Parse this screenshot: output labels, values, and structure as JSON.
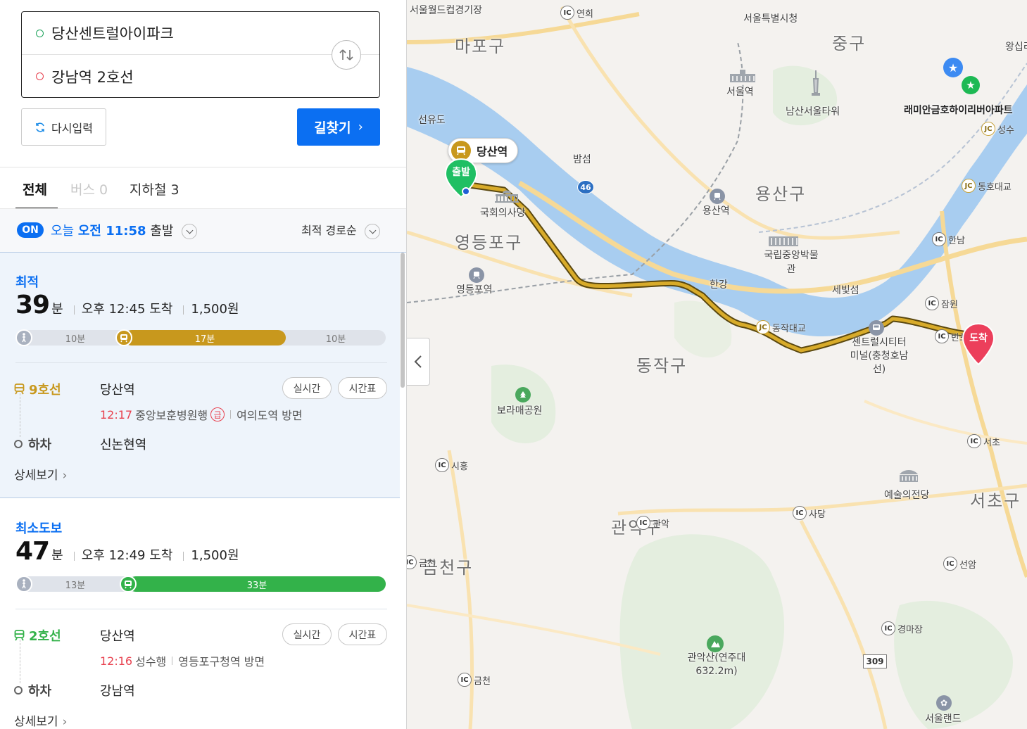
{
  "search": {
    "origin": "당산센트럴아이파크",
    "destination": "강남역 2호선",
    "reset_label": "다시입력",
    "search_label": "길찾기"
  },
  "tabs": [
    {
      "label": "전체",
      "count": ""
    },
    {
      "label": "버스",
      "count": "0"
    },
    {
      "label": "지하철",
      "count": "3"
    }
  ],
  "departure": {
    "badge": "ON",
    "day": "오늘",
    "time": "오전 11:58",
    "suffix": "출발",
    "sort": "최적 경로순"
  },
  "routes": [
    {
      "type": "최적",
      "minutes": "39",
      "unit": "분",
      "arrival": "오후 12:45 도착",
      "fare": "1,500원",
      "segments": [
        {
          "kind": "walk",
          "label": "10분",
          "minutes": 10
        },
        {
          "kind": "subway",
          "label": "17분",
          "minutes": 17
        },
        {
          "kind": "walk",
          "label": "10분",
          "minutes": 10
        }
      ],
      "line_name": "9호선",
      "line_color": "#c8981d",
      "board_station": "당산역",
      "realtime_label": "실시간",
      "timetable_label": "시간표",
      "depart_time": "12:17",
      "direction": "중앙보훈병원행",
      "express": "급",
      "heading": "여의도역 방면",
      "alight_label": "하차",
      "alight_station": "신논현역",
      "detail_label": "상세보기"
    },
    {
      "type": "최소도보",
      "minutes": "47",
      "unit": "분",
      "arrival": "오후 12:49 도착",
      "fare": "1,500원",
      "segments": [
        {
          "kind": "walk",
          "label": "13분",
          "minutes": 13
        },
        {
          "kind": "subway",
          "label": "33분",
          "minutes": 33
        }
      ],
      "line_name": "2호선",
      "line_color": "#33b24a",
      "board_station": "당산역",
      "realtime_label": "실시간",
      "timetable_label": "시간표",
      "depart_time": "12:16",
      "direction": "성수행",
      "heading": "영등포구청역 방면",
      "alight_label": "하차",
      "alight_station": "강남역",
      "detail_label": "상세보기"
    }
  ],
  "map": {
    "districts": [
      "마포구",
      "중구",
      "용산구",
      "영등포구",
      "동작구",
      "관악구",
      "금천구",
      "서초구"
    ],
    "places": [
      "서울월드컵경기장",
      "서울특별시청",
      "서울역",
      "남산서울타워",
      "래미안금호하이리버아파트",
      "밤섬",
      "국회의사당",
      "용산역",
      "국립중앙박물관",
      "한강",
      "세빛섬",
      "영등포역",
      "센트럴시티터미널(충청호남선)",
      "보라매공원",
      "예술의전당",
      "관악산(연주대632.2m)",
      "서울랜드",
      "선유도",
      "왕십리"
    ],
    "ic_labels": [
      "연희",
      "성수",
      "동호대교",
      "한남",
      "잠원",
      "반포",
      "서초",
      "동작대교",
      "시흥",
      "사당",
      "관악",
      "선암",
      "경마장",
      "금천",
      "금천"
    ],
    "road_number": [
      "46",
      "309"
    ],
    "start_station": "당산역",
    "start_label": "출발",
    "end_label": "도착"
  }
}
